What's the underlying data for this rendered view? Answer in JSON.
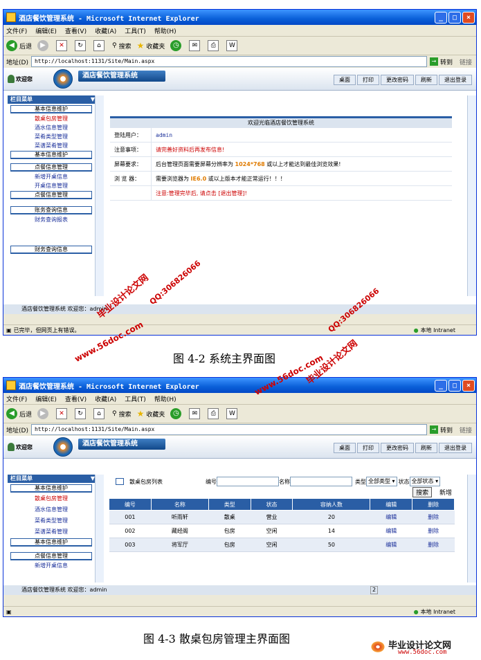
{
  "browser": {
    "window_title": "酒店餐饮管理系统 - Microsoft Internet Explorer",
    "menu": [
      "文件(F)",
      "编辑(E)",
      "查看(V)",
      "收藏(A)",
      "工具(T)",
      "帮助(H)"
    ],
    "toolbar": {
      "back": "后退",
      "search": "搜索",
      "favorites": "收藏夹"
    },
    "address_label": "地址(D)",
    "address": "http://localhost:1131/Site/Main.aspx",
    "go": "转到",
    "links": "链接",
    "status_text_1": "已完毕，但网页上有错误。",
    "zone": "本地 Intranet"
  },
  "app": {
    "welcome": "欢迎您",
    "name": "酒店餐饮管理系统",
    "nav": [
      "桌面",
      "打印",
      "更改密码",
      "刷新",
      "退出登录"
    ],
    "footer": "酒店餐饮管理系统 欢迎您：admin"
  },
  "sidebar": {
    "header": "栏目菜单",
    "group1_title": "基本信息维护",
    "group1_links": [
      "散桌包房管理",
      "酒水信息管理",
      "菜肴类型管理",
      "菜谱菜肴管理"
    ],
    "group1_footer": "基本信息维护",
    "group2_title": "点餐信息管理",
    "group2_links": [
      "新增开桌信息",
      "开桌信息管理"
    ],
    "group2_footer": "点餐信息管理",
    "group3_title": "账务查询信息",
    "group3_links": [
      "财务查询报表"
    ],
    "group3_footer": "财务查询信息"
  },
  "home": {
    "title": "欢迎光临酒店餐饮管理系统",
    "rows": [
      {
        "label": "登陆用户：",
        "value": "admin"
      },
      {
        "label": "注意事项：",
        "value": "请完善好资料后再发布信息!"
      },
      {
        "label": "屏幕要求：",
        "value_pre": "后台管理页面需要屏幕分辨率为",
        "value_hl": "1024*768",
        "value_post": "或以上才能达到最佳浏览效果!"
      },
      {
        "label": "浏 览 器：",
        "value_pre": "需要浏览器为",
        "value_hl": "IE6.0",
        "value_post": "或以上版本才能正常运行！！！"
      }
    ],
    "logout_note": "注意:管理完毕后, 请点击 [退出管理]!"
  },
  "list_page": {
    "title": "散桌包房列表",
    "filter_no_label": "编号",
    "filter_name_label": "名称",
    "filter_type_label": "类型",
    "filter_type_value": "全部类型",
    "filter_status_label": "状态",
    "filter_status_value": "全部状态",
    "search_btn": "搜索",
    "add_btn": "新增",
    "columns": [
      "编号",
      "名称",
      "类型",
      "状态",
      "容纳人数",
      "编辑",
      "删除"
    ],
    "rows": [
      [
        "001",
        "听雨轩",
        "散桌",
        "营业",
        "20",
        "编辑",
        "删除"
      ],
      [
        "002",
        "藏经阁",
        "包房",
        "空闲",
        "14",
        "编辑",
        "删除"
      ],
      [
        "003",
        "将军厅",
        "包房",
        "空闲",
        "50",
        "编辑",
        "删除"
      ]
    ],
    "status_cell": "2"
  },
  "captions": {
    "fig1": "图 4-2 系统主界面图",
    "fig2": "图 4-3 散桌包房管理主界面图"
  },
  "watermarks": {
    "site": "www.56doc.com",
    "qq": "QQ:306826066",
    "brand": "毕业设计论文网",
    "footer_brand": "毕业设计论文网",
    "footer_site": "www.56doc.com"
  }
}
